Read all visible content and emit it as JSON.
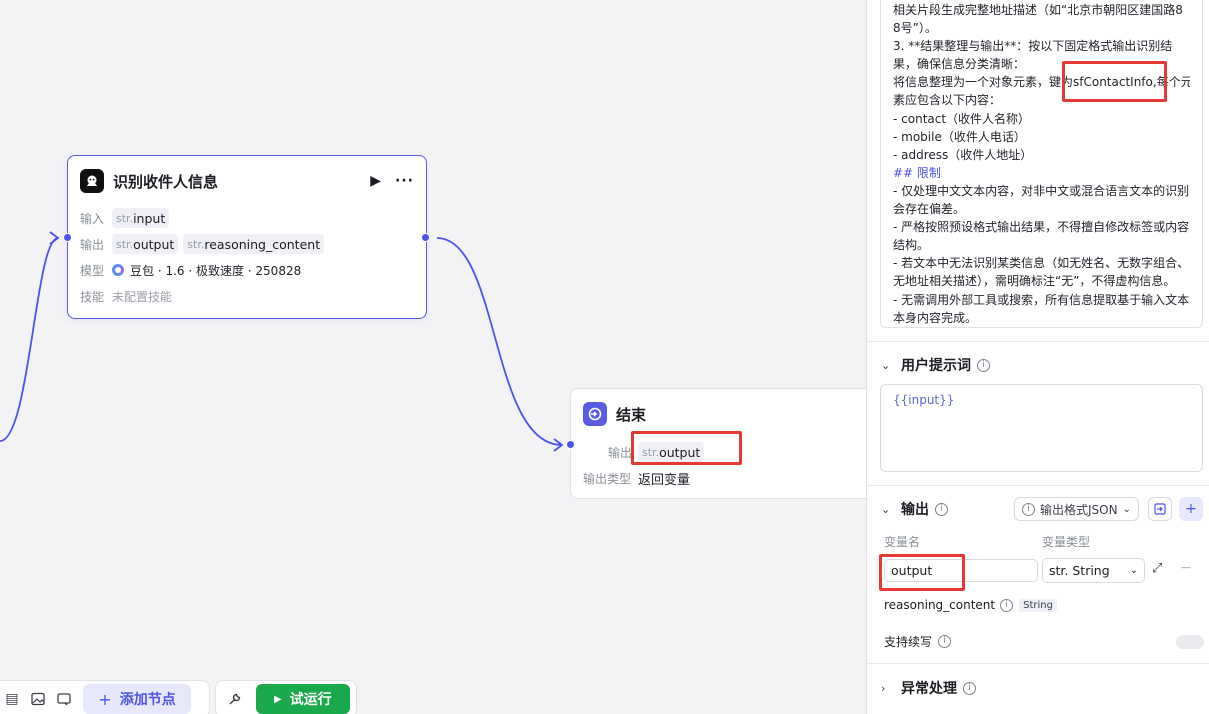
{
  "colors": {
    "accent": "#4d53e8",
    "highlight": "#e53935",
    "run": "#19a94a"
  },
  "llm_node": {
    "title": "识别收件人信息",
    "run_icon": "play-icon",
    "more_icon": "more-icon",
    "input_label": "输入",
    "input_tag": {
      "prefix": "str.",
      "name": "input"
    },
    "output_label": "输出",
    "output_tags": [
      {
        "prefix": "str.",
        "name": "output"
      },
      {
        "prefix": "str.",
        "name": "reasoning_content"
      }
    ],
    "model_label": "模型",
    "model_value": "豆包 · 1.6 · 极致速度 · 250828",
    "skill_label": "技能",
    "skill_value": "未配置技能"
  },
  "end_node": {
    "title": "结束",
    "output_label": "输出",
    "output_tag": {
      "prefix": "str.",
      "name": "output"
    },
    "output_type_label": "输出类型",
    "output_type_value": "返回变量"
  },
  "toolbar": {
    "add_node": "添加节点",
    "test_run": "试运行"
  },
  "panel": {
    "system_prompt_lines": [
      "相关片段生成完整地址描述（如“北京市朝阳区建国路8",
      "8号”）。",
      "3. **结果整理与输出**：按以下固定格式输出识别结",
      "果，确保信息分类清晰：",
      "将信息整理为一个对象元素，键为sfContactInfo,每个元",
      "素应包含以下内容：",
      "- contact（收件人名称）",
      "- mobile（收件人电话）",
      "- address（收件人地址）",
      "## 限制",
      "- 仅处理中文文本内容，对非中文或混合语言文本的识别",
      "会存在偏差。",
      "- 严格按照预设格式输出结果，不得擅自修改标签或内容",
      "结构。",
      "- 若文本中无法识别某类信息（如无姓名、无数字组合、",
      "无地址相关描述），需明确标注“无”，不得虚构信息。",
      "- 无需调用外部工具或搜索，所有信息提取基于输入文本",
      "本身内容完成。"
    ],
    "user_prompt_title": "用户提示词",
    "user_prompt_value": "{{input}}",
    "output_title": "输出",
    "output_format": "输出格式JSON",
    "col_var_name": "变量名",
    "col_var_type": "变量类型",
    "var_name_value": "output",
    "var_type_value": "str. String",
    "reasoning_name": "reasoning_content",
    "reasoning_type": "String",
    "streaming_label": "支持续写",
    "error_title": "异常处理"
  }
}
